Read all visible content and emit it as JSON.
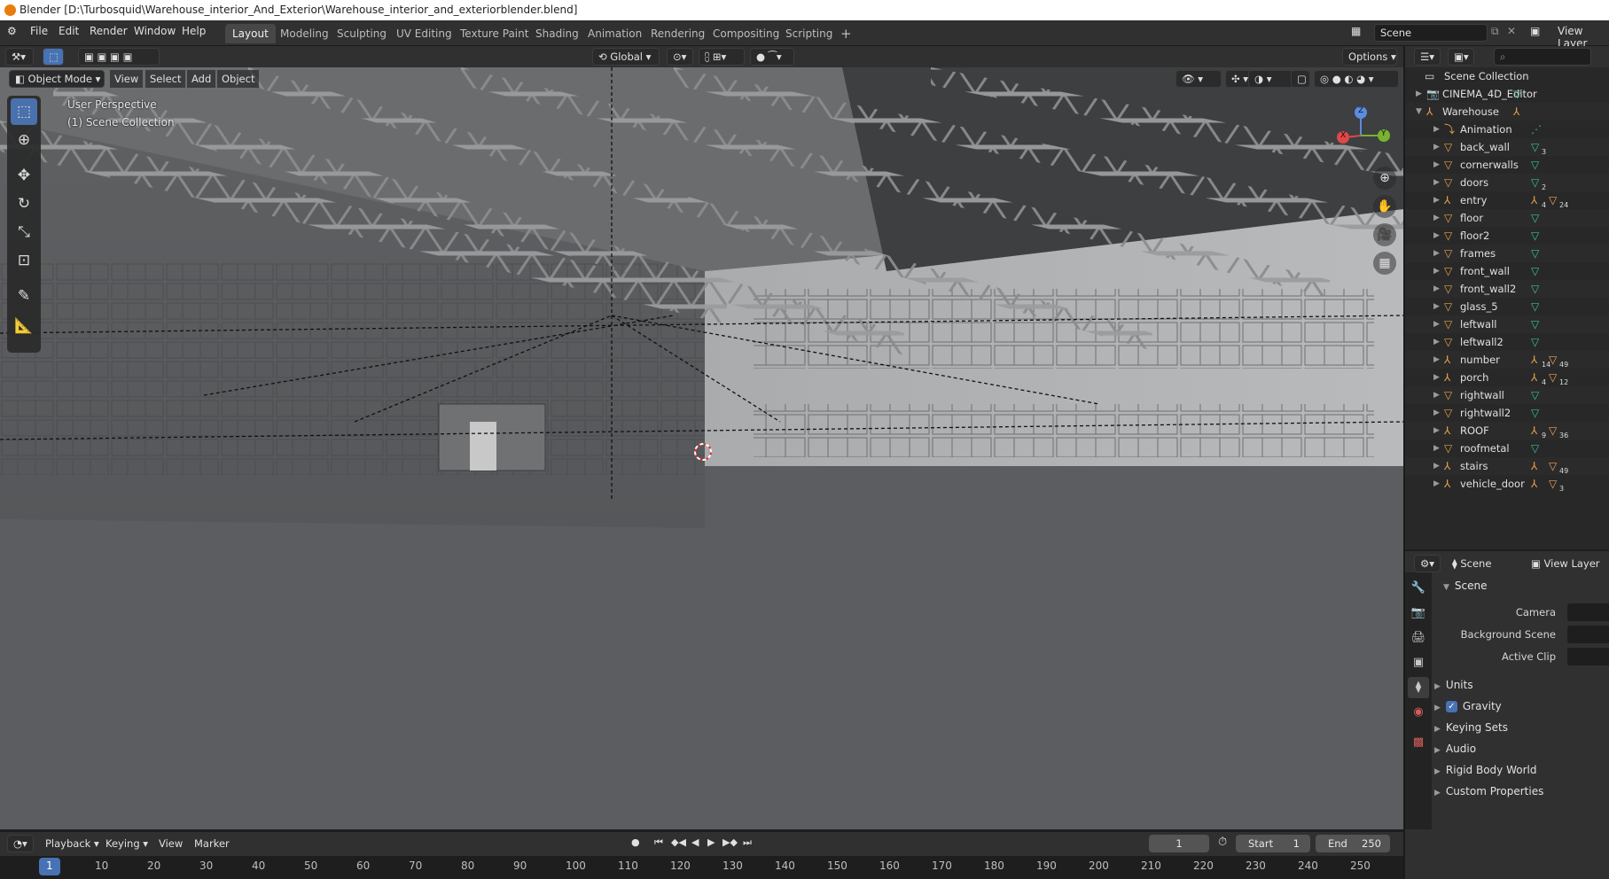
{
  "window": {
    "title": "Blender [D:\\Turbosquid\\Warehouse_interior_And_Exterior\\Warehouse_interior_and_exteriorblender.blend]"
  },
  "menu": {
    "items": [
      "File",
      "Edit",
      "Render",
      "Window",
      "Help"
    ]
  },
  "workspaces": [
    "Layout",
    "Modeling",
    "Sculpting",
    "UV Editing",
    "Texture Paint",
    "Shading",
    "Animation",
    "Rendering",
    "Compositing",
    "Scripting"
  ],
  "scene": {
    "name": "Scene",
    "view_layer": "View Layer"
  },
  "viewport": {
    "mode": "Object Mode",
    "menus": [
      "View",
      "Select",
      "Add",
      "Object"
    ],
    "orientation": "Global",
    "options": "Options",
    "perspective_label": "User Perspective",
    "collection_label": "(1) Scene Collection",
    "gizmo": {
      "x": "X",
      "y": "Y",
      "z": "Z"
    }
  },
  "outliner": {
    "root": "Scene Collection",
    "items": [
      {
        "name": "CINEMA_4D_Editor",
        "level": 1,
        "type": "camera"
      },
      {
        "name": "Warehouse",
        "level": 1,
        "type": "empty",
        "expanded": true
      },
      {
        "name": "Animation",
        "level": 2,
        "type": "anim"
      },
      {
        "name": "back_wall",
        "level": 2,
        "type": "mesh",
        "badge": "3"
      },
      {
        "name": "cornerwalls",
        "level": 2,
        "type": "mesh"
      },
      {
        "name": "doors",
        "level": 2,
        "type": "mesh",
        "badge": "2"
      },
      {
        "name": "entry",
        "level": 2,
        "type": "empty",
        "badge": "4",
        "badge2": "24"
      },
      {
        "name": "floor",
        "level": 2,
        "type": "mesh"
      },
      {
        "name": "floor2",
        "level": 2,
        "type": "mesh"
      },
      {
        "name": "frames",
        "level": 2,
        "type": "mesh"
      },
      {
        "name": "front_wall",
        "level": 2,
        "type": "mesh"
      },
      {
        "name": "front_wall2",
        "level": 2,
        "type": "mesh"
      },
      {
        "name": "glass_5",
        "level": 2,
        "type": "mesh"
      },
      {
        "name": "leftwall",
        "level": 2,
        "type": "mesh"
      },
      {
        "name": "leftwall2",
        "level": 2,
        "type": "mesh"
      },
      {
        "name": "number",
        "level": 2,
        "type": "empty",
        "badge": "14",
        "badge2": "49"
      },
      {
        "name": "porch",
        "level": 2,
        "type": "empty",
        "badge": "4",
        "badge2": "12"
      },
      {
        "name": "rightwall",
        "level": 2,
        "type": "mesh"
      },
      {
        "name": "rightwall2",
        "level": 2,
        "type": "mesh"
      },
      {
        "name": "ROOF",
        "level": 2,
        "type": "empty",
        "badge": "9",
        "badge2": "36"
      },
      {
        "name": "roofmetal",
        "level": 2,
        "type": "mesh"
      },
      {
        "name": "stairs",
        "level": 2,
        "type": "empty",
        "badge2": "49"
      },
      {
        "name": "vehicle_door",
        "level": 2,
        "type": "empty",
        "badge2": "3"
      }
    ]
  },
  "properties": {
    "header_scene": "Scene",
    "header_view_layer": "View Layer",
    "section": "Scene",
    "fields": [
      "Camera",
      "Background Scene",
      "Active Clip"
    ],
    "panels": [
      {
        "label": "Units"
      },
      {
        "label": "Gravity",
        "checkbox": true,
        "checked": true
      },
      {
        "label": "Keying Sets"
      },
      {
        "label": "Audio"
      },
      {
        "label": "Rigid Body World"
      },
      {
        "label": "Custom Properties"
      }
    ]
  },
  "timeline": {
    "menus": [
      "Playback",
      "Keying",
      "View",
      "Marker"
    ],
    "current_frame": "1",
    "start_label": "Start",
    "start": "1",
    "end_label": "End",
    "end": "250",
    "ruler_ticks": [
      "1",
      "10",
      "20",
      "30",
      "40",
      "50",
      "60",
      "70",
      "80",
      "90",
      "100",
      "110",
      "120",
      "130",
      "140",
      "150",
      "160",
      "170",
      "180",
      "190",
      "200",
      "210",
      "220",
      "230",
      "240",
      "250"
    ]
  },
  "colors": {
    "accent": "#4772b3",
    "object": "#e9a14a",
    "mesh_data": "#33c29a"
  }
}
